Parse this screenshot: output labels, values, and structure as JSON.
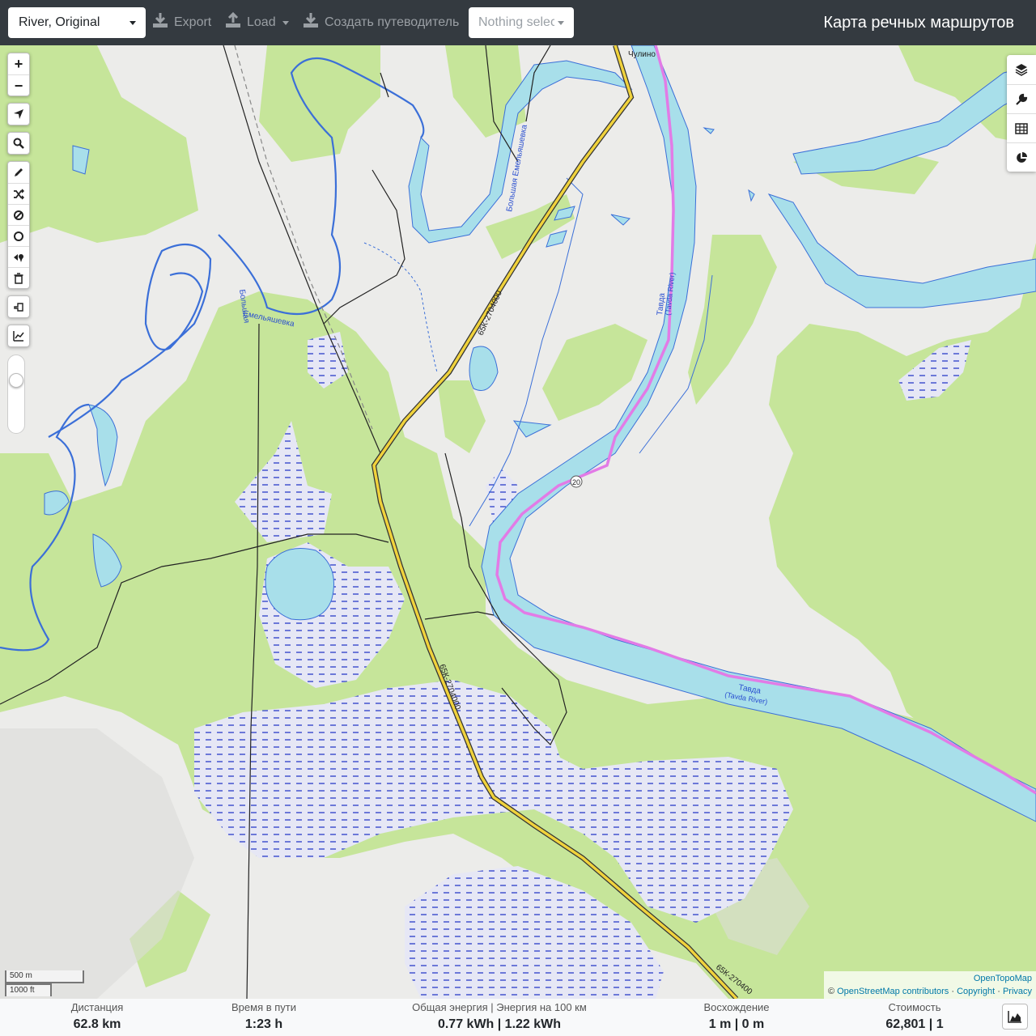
{
  "navbar": {
    "profile_select": "River, Original",
    "export_label": "Export",
    "load_label": "Load",
    "guide_label": "Создать путеводитель",
    "nothing_selected": "Nothing selected",
    "app_title": "Карта речных маршрутов"
  },
  "map": {
    "labels": {
      "village": "Чулино",
      "stream_big": "Большая Емельяшевка",
      "stream_small_1": "Большая",
      "stream_small_2": "Емельяшевка",
      "river_ru_1": "Тавда",
      "river_en_1": "(Tavda River)",
      "river_ru_2": "Тавда",
      "river_en_2": "(Tavda River)",
      "road_1": "65К-2704000",
      "road_2": "65К-2704000",
      "road_3": "65К-270400",
      "road_shield": "20"
    },
    "scale_metric": "500 m",
    "scale_imperial": "1000 ft",
    "attribution_top": "OpenTopoMap",
    "attribution_osm": "OpenStreetMap contributors",
    "attribution_copyright": "Copyright",
    "attribution_privacy": "Privacy",
    "attribution_prefix": "©",
    "colors": {
      "forest": "#c6e59a",
      "water": "#a8dfea",
      "water_line": "#3b6fd8",
      "route": "#e27be6",
      "road": "#f0d23c",
      "marsh": "#e4e6f4"
    }
  },
  "controls": {
    "zoom_in": "+",
    "zoom_out": "−",
    "left_icons": [
      "locate-icon",
      "search-icon",
      "draw-icon",
      "shuffle-icon",
      "nogo-icon",
      "circle-icon",
      "poi-icon",
      "delete-icon",
      "undo-icon",
      "elevation-icon"
    ],
    "right_icons": [
      "layers-icon",
      "wrench-icon",
      "table-icon",
      "pie-chart-icon"
    ]
  },
  "stats": {
    "distance_label": "Дистанция",
    "distance_value": "62.8",
    "distance_unit": "km",
    "time_label": "Время в пути",
    "time_value": "1:23",
    "time_unit": "h",
    "energy_label": "Общая энергия | Энергия на 100 км",
    "energy_value": "0.77 kWh | 1.22 kWh",
    "ascent_label": "Восхождение",
    "ascent_value": "1 m | 0 m",
    "cost_label": "Стоимость",
    "cost_value": "62,801 | 1"
  }
}
